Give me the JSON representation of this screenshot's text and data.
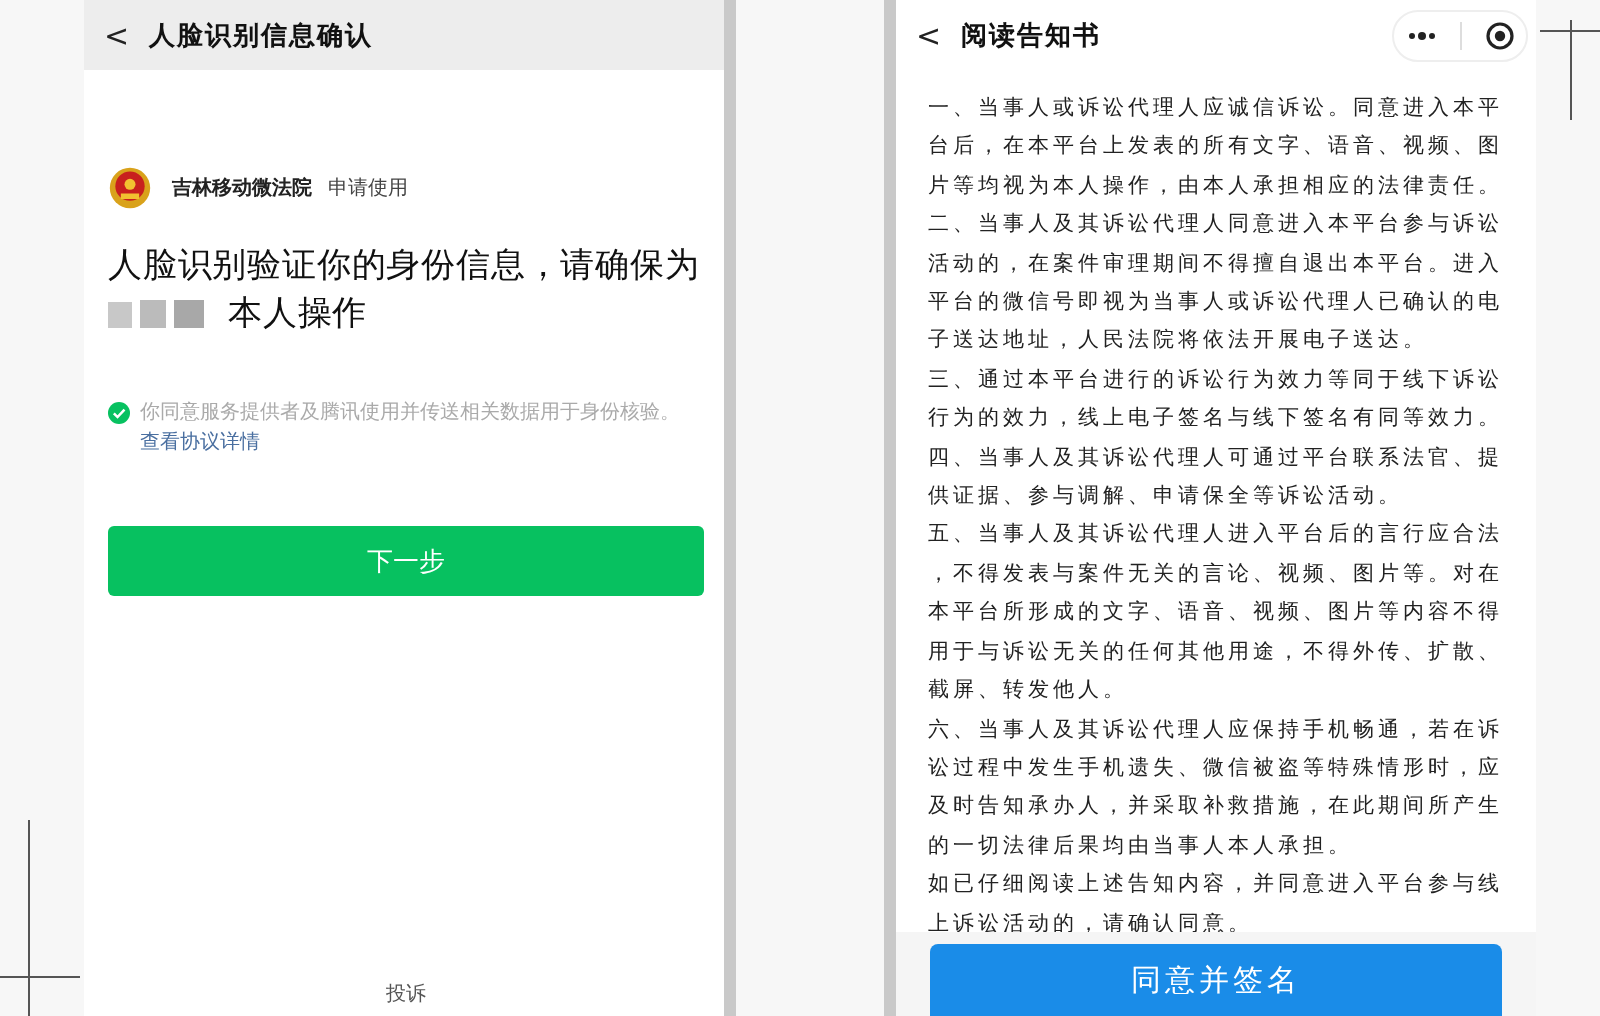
{
  "left_screen": {
    "header": {
      "back": "<",
      "title": "人脸识别信息确认"
    },
    "app_name": "吉林移动微法院",
    "app_action": "申请使用",
    "heading": "人脸识别验证你的身份信息，请确保为",
    "heading_suffix": "本人操作",
    "name_redacted": true,
    "consent": {
      "checked": true,
      "text": "你同意服务提供者及腾讯使用并传送相关数据用于身份核验。",
      "link": "查看协议详情"
    },
    "next_button": "下一步",
    "footer_link": "投诉"
  },
  "right_screen": {
    "header": {
      "back": "<",
      "title": "阅读告知书"
    },
    "paragraphs": [
      "一、当事人或诉讼代理人应诚信诉讼。同意进入本平台后，在本平台上发表的所有文字、语音、视频、图片等均视为本人操作，由本人承担相应的法律责任。",
      "二、当事人及其诉讼代理人同意进入本平台参与诉讼活动的，在案件审理期间不得擅自退出本平台。进入平台的微信号即视为当事人或诉讼代理人已确认的电子送达地址，人民法院将依法开展电子送达。",
      "三、通过本平台进行的诉讼行为效力等同于线下诉讼行为的效力，线上电子签名与线下签名有同等效力。",
      "四、当事人及其诉讼代理人可通过平台联系法官、提供证据、参与调解、申请保全等诉讼活动。",
      "五、当事人及其诉讼代理人进入平台后的言行应合法，不得发表与案件无关的言论、视频、图片等。对在本平台所形成的文字、语音、视频、图片等内容不得用于与诉讼无关的任何其他用途，不得外传、扩散、截屏、转发他人。",
      "六、当事人及其诉讼代理人应保持手机畅通，若在诉讼过程中发生手机遗失、微信被盗等特殊情形时，应及时告知承办人，并采取补救措施，在此期间所产生的一切法律后果均由当事人本人承担。",
      "如已仔细阅读上述告知内容，并同意进入平台参与线上诉讼活动的，请确认同意。"
    ],
    "sign_button": "同意并签名"
  }
}
